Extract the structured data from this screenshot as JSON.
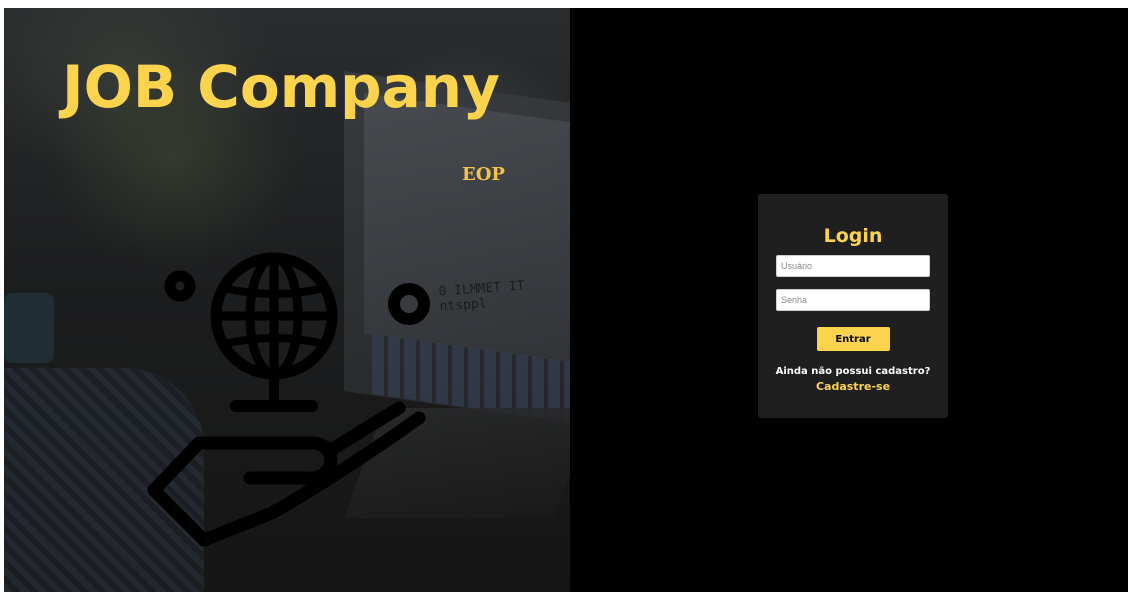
{
  "hero": {
    "title": "JOB Company",
    "subtitle": "EOP",
    "illustration_icon": "globe-in-hand-icon",
    "background_code_text": "0 ILMMET IT ntsppl"
  },
  "login": {
    "title": "Login",
    "username_placeholder": "Usuário",
    "password_placeholder": "Senha",
    "submit_label": "Entrar",
    "no_account_text": "Ainda não possui cadastro?",
    "signup_link": "Cadastre-se"
  },
  "colors": {
    "accent": "#fcd34d",
    "background": "#000000",
    "card": "#1f1f1f"
  }
}
